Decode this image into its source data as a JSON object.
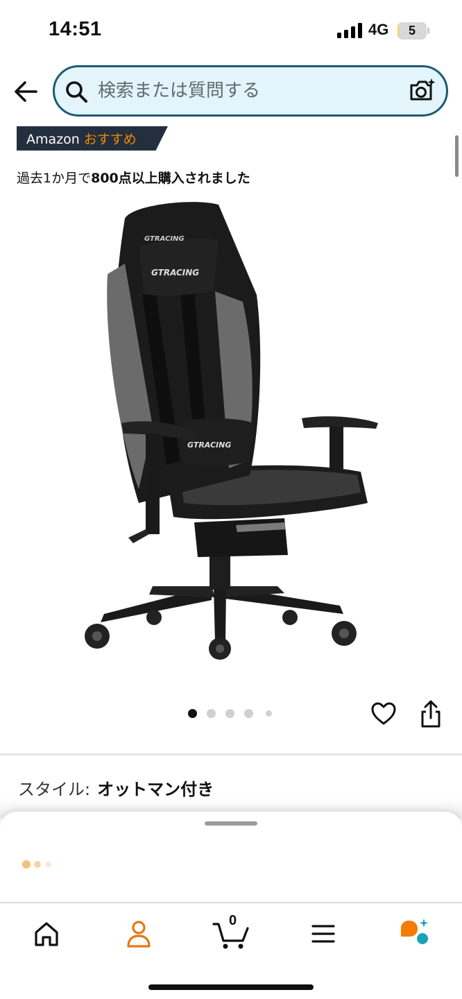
{
  "status_bar": {
    "time": "14:51",
    "network": "4G",
    "battery_level": "5",
    "battery_fraction": 0.05
  },
  "search": {
    "placeholder": "検索または質問する"
  },
  "badge": {
    "brand": "Amazon",
    "highlight": "おすすめ",
    "colors": {
      "background": "#232f3e",
      "highlight": "#f08804"
    }
  },
  "purchase_note": {
    "prefix": "過去1か月で",
    "emphasis": "800点以上購入されました"
  },
  "product": {
    "image_alt": "gaming-chair-image",
    "brand_mark": "GTRACING"
  },
  "carousel": {
    "total": 5,
    "active_index": 0
  },
  "style_option": {
    "label": "スタイル:",
    "value": "オットマン付き"
  },
  "bottom_nav": {
    "items": [
      "home-icon",
      "account-icon",
      "cart-icon",
      "menu-icon",
      "rufus-icon"
    ],
    "cart_count": "0",
    "colors": {
      "account": "#e47911",
      "rufus_orange": "#f57c00",
      "rufus_teal": "#1aa3b5"
    }
  }
}
